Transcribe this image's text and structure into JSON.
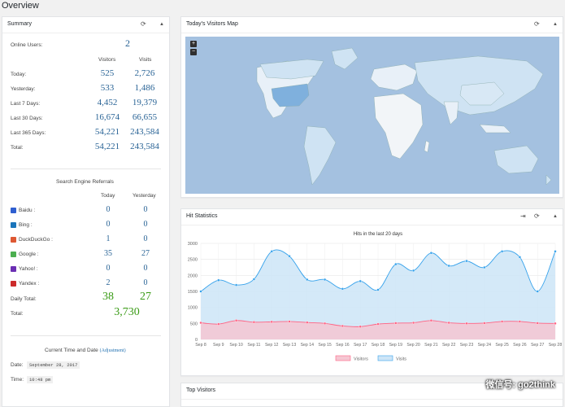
{
  "page": {
    "title": "Overview"
  },
  "summary": {
    "title": "Summary",
    "online_label": "Online Users:",
    "online_value": "2",
    "col_visitors": "Visitors",
    "col_visits": "Visits",
    "rows": [
      {
        "label": "Today:",
        "visitors": "525",
        "visits": "2,726"
      },
      {
        "label": "Yesterday:",
        "visitors": "533",
        "visits": "1,486"
      },
      {
        "label": "Last 7 Days:",
        "visitors": "4,452",
        "visits": "19,379"
      },
      {
        "label": "Last 30 Days:",
        "visitors": "16,674",
        "visits": "66,655"
      },
      {
        "label": "Last 365 Days:",
        "visitors": "54,221",
        "visits": "243,584"
      },
      {
        "label": "Total:",
        "visitors": "54,221",
        "visits": "243,584"
      }
    ],
    "se_title": "Search Engine Referrals",
    "col_today": "Today",
    "col_yesterday": "Yesterday",
    "engines": [
      {
        "label": "Baidu :",
        "today": "0",
        "yesterday": "0",
        "color": "#2f5fd0"
      },
      {
        "label": "Bing :",
        "today": "0",
        "yesterday": "0",
        "color": "#1b75bb"
      },
      {
        "label": "DuckDuckGo :",
        "today": "1",
        "yesterday": "0",
        "color": "#de5833"
      },
      {
        "label": "Google :",
        "today": "35",
        "yesterday": "27",
        "color": "#4caf50"
      },
      {
        "label": "Yahoo! :",
        "today": "0",
        "yesterday": "0",
        "color": "#6b2fb3"
      },
      {
        "label": "Yandex :",
        "today": "2",
        "yesterday": "0",
        "color": "#cc2b2b"
      }
    ],
    "daily_total_label": "Daily Total:",
    "daily_total_today": "38",
    "daily_total_yesterday": "27",
    "total_label": "Total:",
    "total_value": "3,730",
    "time_title": "Current Time and Date",
    "adjustment": "(Adjustment)",
    "date_label": "Date:",
    "date_value": "September 28, 2017",
    "time_label": "Time:",
    "time_value": "10:48 pm"
  },
  "map": {
    "title": "Today's Visitors Map",
    "zoom_in": "+",
    "zoom_out": "−"
  },
  "hits": {
    "title": "Hit Statistics"
  },
  "top_visitors": {
    "title": "Top Visitors"
  },
  "icons": {
    "refresh": "refresh-icon",
    "collapse": "collapse-icon",
    "export": "export-icon"
  },
  "watermark": "微信号: go2think",
  "chart_data": {
    "type": "line",
    "title": "Hits in the last 20 days",
    "categories": [
      "Sep 8",
      "Sep 9",
      "Sep 10",
      "Sep 11",
      "Sep 12",
      "Sep 13",
      "Sep 14",
      "Sep 15",
      "Sep 16",
      "Sep 17",
      "Sep 18",
      "Sep 19",
      "Sep 20",
      "Sep 21",
      "Sep 22",
      "Sep 23",
      "Sep 24",
      "Sep 25",
      "Sep 26",
      "Sep 27",
      "Sep 28"
    ],
    "ylim": [
      0,
      3000
    ],
    "yticks": [
      0,
      500,
      1000,
      1500,
      2000,
      2500,
      3000
    ],
    "grid": true,
    "legend": "bottom",
    "series": [
      {
        "name": "Visitors",
        "color": "#ff6384",
        "fill": "#f5c6d2",
        "values": [
          520,
          480,
          590,
          540,
          550,
          560,
          530,
          500,
          420,
          400,
          480,
          510,
          520,
          590,
          520,
          500,
          510,
          560,
          560,
          510,
          500
        ]
      },
      {
        "name": "Visits",
        "color": "#36a2eb",
        "fill": "#cde5f7",
        "values": [
          1500,
          1850,
          1700,
          1880,
          2750,
          2600,
          1870,
          1870,
          1580,
          1820,
          1550,
          2350,
          2150,
          2700,
          2300,
          2450,
          2250,
          2750,
          2570,
          1500,
          2750
        ]
      }
    ]
  }
}
